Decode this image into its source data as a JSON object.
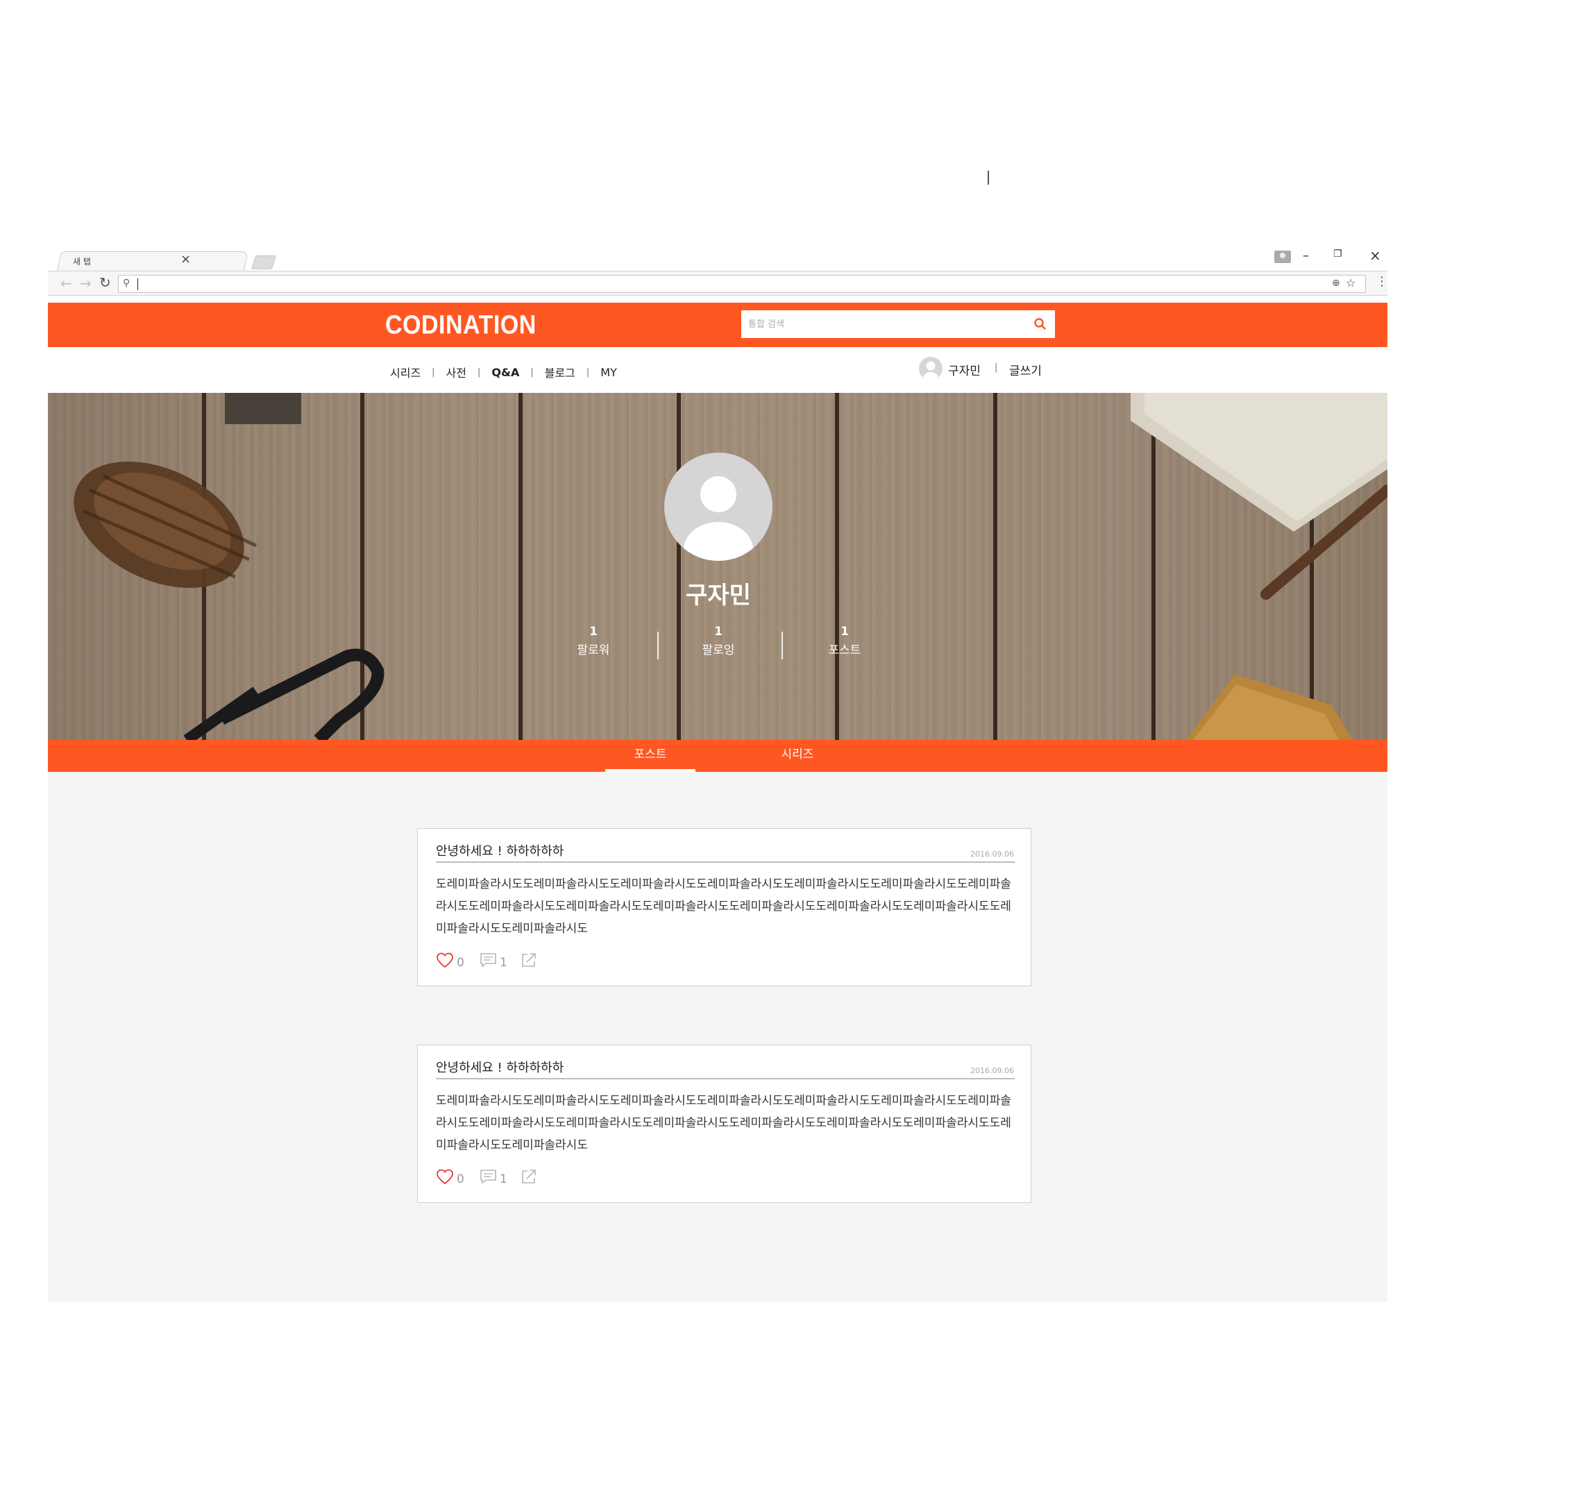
{
  "browser": {
    "tab_title": "새 탭",
    "tab_close": "×",
    "address_value": ""
  },
  "site": {
    "brand": "CODINATION",
    "accent_color": "#ff5722",
    "search_placeholder": "통합 검색",
    "nav": [
      "시리즈",
      "사전",
      "Q&A",
      "블로그",
      "MY"
    ],
    "nav_separator": "|",
    "user_name": "구자민",
    "write_label": "글쓰기"
  },
  "profile": {
    "name": "구자민",
    "stats": [
      {
        "count": "1",
        "label": "팔로워"
      },
      {
        "count": "1",
        "label": "팔로잉"
      },
      {
        "count": "1",
        "label": "포스트"
      }
    ]
  },
  "tabs": [
    {
      "label": "포스트",
      "active": true
    },
    {
      "label": "시리즈",
      "active": false
    }
  ],
  "posts": [
    {
      "title": "안녕하세요 ! 하하하하하",
      "date": "2016.09.06",
      "body": "도레미파솔라시도도레미파솔라시도도레미파솔라시도도레미파솔라시도도레미파솔라시도도레미파솔라시도도레미파솔라시도도레미파솔라시도도레미파솔라시도도레미파솔라시도도레미파솔라시도도레미파솔라시도도레미파솔라시도도레미파솔라시도도레미파솔라시도",
      "likes": "0",
      "comments": "1"
    },
    {
      "title": "안녕하세요 ! 하하하하하",
      "date": "2016.09.06",
      "body": "도레미파솔라시도도레미파솔라시도도레미파솔라시도도레미파솔라시도도레미파솔라시도도레미파솔라시도도레미파솔라시도도레미파솔라시도도레미파솔라시도도레미파솔라시도도레미파솔라시도도레미파솔라시도도레미파솔라시도도레미파솔라시도도레미파솔라시도",
      "likes": "0",
      "comments": "1"
    }
  ]
}
